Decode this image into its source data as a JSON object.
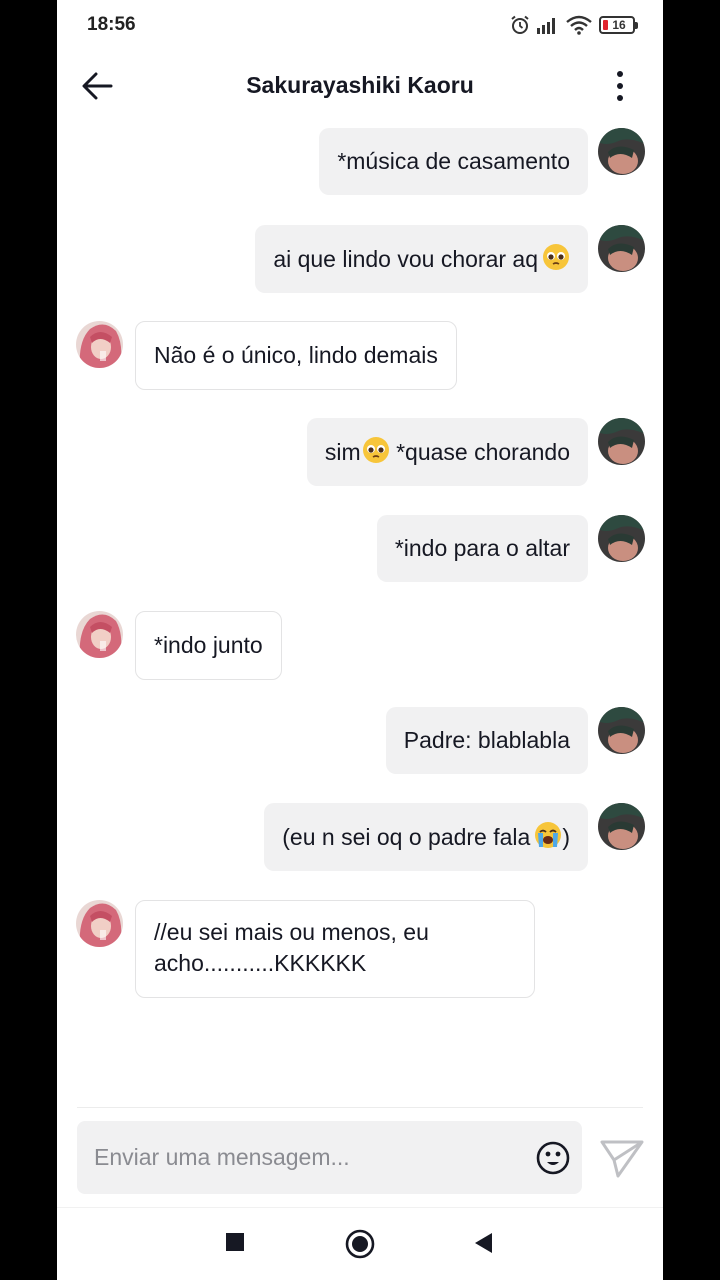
{
  "status_bar": {
    "time": "18:56",
    "battery": "16",
    "battery_color": "#e0232d"
  },
  "header": {
    "title": "Sakurayashiki Kaoru",
    "back_icon": "arrow-left-icon",
    "more_icon": "more-vertical-icon"
  },
  "messages": [
    {
      "side": "right",
      "text": "*música de casamento"
    },
    {
      "side": "right",
      "text": "ai que lindo vou chorar aq",
      "emoji": "pleading-face"
    },
    {
      "side": "left",
      "text": "Não é o único, lindo demais"
    },
    {
      "side": "right",
      "text_before": "sim",
      "emoji": "pleading-face",
      "text_after": " *quase chorando"
    },
    {
      "side": "right",
      "text": "*indo para o altar"
    },
    {
      "side": "left",
      "text": "*indo junto"
    },
    {
      "side": "right",
      "text": "Padre: blablabla"
    },
    {
      "side": "right",
      "text_before": "(eu n sei oq o padre fala",
      "emoji": "loudly-crying-face",
      "text_after": ")"
    },
    {
      "side": "left",
      "text": "//eu sei mais ou menos, eu acho...........KKKKKK"
    }
  ],
  "composer": {
    "placeholder": "Enviar uma mensagem...",
    "emoji_icon": "smiley-icon",
    "send_icon": "send-icon"
  },
  "nav_bar": {
    "recents_icon": "square-icon",
    "home_icon": "circle-icon",
    "back_icon": "triangle-back-icon"
  },
  "colors": {
    "outgoing_bubble": "#f1f1f2",
    "incoming_border": "#e3e3e4",
    "text": "#161823",
    "placeholder": "#8a8b91"
  }
}
